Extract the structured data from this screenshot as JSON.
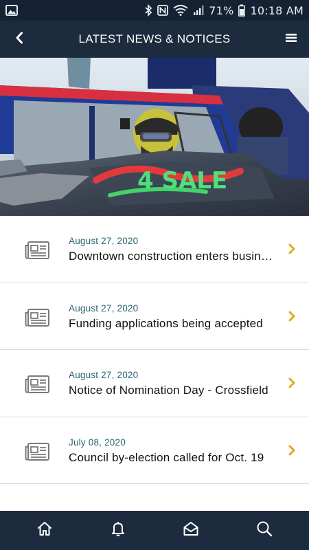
{
  "status_bar": {
    "battery": "71%",
    "time": "10:18 AM"
  },
  "header": {
    "title": "LATEST NEWS & NOTICES"
  },
  "hero": {
    "car_text": "4 SALE"
  },
  "news": [
    {
      "date": "August 27, 2020",
      "title": "Downtown construction enters business district"
    },
    {
      "date": "August 27, 2020",
      "title": "Funding applications being accepted"
    },
    {
      "date": "August 27, 2020",
      "title": "Notice of Nomination Day - Crossfield"
    },
    {
      "date": "July 08, 2020",
      "title": "Council by-election called for Oct. 19"
    }
  ],
  "colors": {
    "header_bg": "#1c2b3d",
    "status_bg": "#152233",
    "date_color": "#2a6470",
    "chevron": "#e3a81c",
    "icon_gray": "#7a7a7a"
  },
  "icons": {
    "back": "chevron-left-icon",
    "menu": "hamburger-menu-icon",
    "news": "newspaper-icon",
    "nav": [
      "home-icon",
      "bell-icon",
      "envelope-open-icon",
      "search-icon"
    ]
  }
}
